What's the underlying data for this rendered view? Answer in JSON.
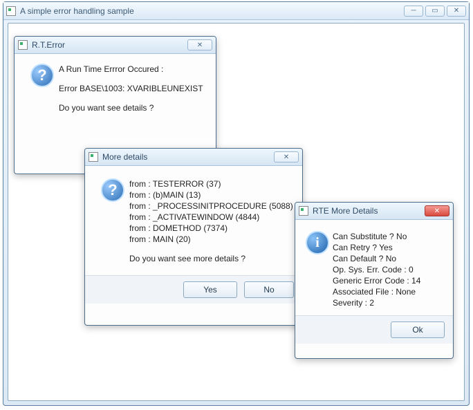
{
  "app": {
    "title": "A simple error handling sample"
  },
  "dlg1": {
    "title": "R.T.Error",
    "line1": "A Run Time Errror Occured :",
    "line2": "Error BASE\\1003: XVARIBLEUNEXIST",
    "line3": "Do you want see details ?"
  },
  "dlg2": {
    "title": "More details",
    "l1": "from : TESTERROR (37)",
    "l2": "from : (b)MAIN (13)",
    "l3": "from : _PROCESSINITPROCEDURE (5088)",
    "l4": "from : _ACTIVATEWINDOW (4844)",
    "l5": "from : DOMETHOD (7374)",
    "l6": "from : MAIN (20)",
    "prompt": "Do you want see more details ?",
    "yes": "Yes",
    "no": "No"
  },
  "dlg3": {
    "title": "RTE More Details",
    "l1": "Can Substitute ? No",
    "l2": "Can Retry ? Yes",
    "l3": "Can Default ? No",
    "l4": "Op. Sys. Err. Code : 0",
    "l5": "Generic Error Code : 14",
    "l6": "Associated File : None",
    "l7": "Severity : 2",
    "ok": "Ok"
  }
}
